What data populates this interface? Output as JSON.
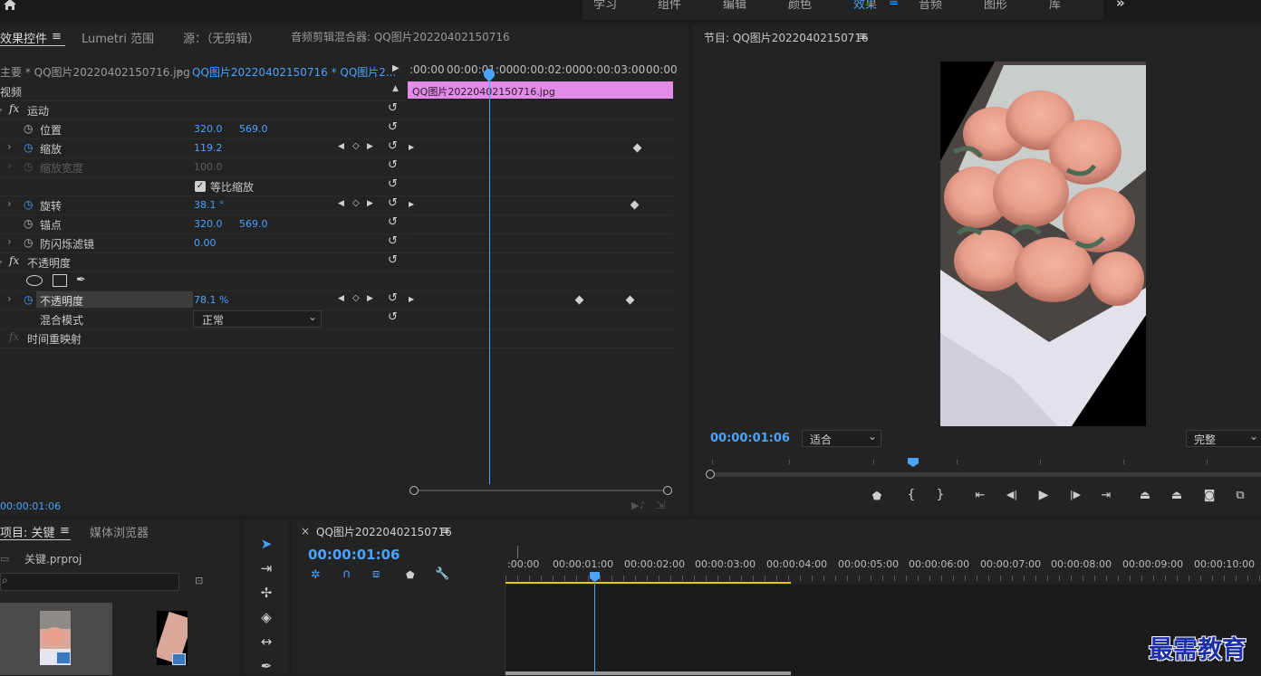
{
  "top_nav": {
    "items": [
      "学习",
      "组件",
      "编辑",
      "颜色",
      "效果",
      "音频",
      "图形",
      "库"
    ],
    "active_index": 4,
    "more": "»"
  },
  "effect_controls": {
    "tabs": [
      "效果控件",
      "Lumetri 范围",
      "源：（无剪辑）",
      "音频剪辑混合器: QQ图片20220402150716"
    ],
    "active_tab_menu": "≡",
    "master_clip": "主要 * QQ图片20220402150716.jpg",
    "sequence_clip": "QQ图片20220402150716 * QQ图片2...",
    "video_header": "视频",
    "motion": "运动",
    "position": {
      "label": "位置",
      "x": "320.0",
      "y": "569.0"
    },
    "scale": {
      "label": "缩放",
      "value": "119.2"
    },
    "scale_width": {
      "label": "缩放宽度",
      "value": "100.0"
    },
    "uniform_scale": "等比缩放",
    "rotation": {
      "label": "旋转",
      "value": "38.1 °"
    },
    "anchor": {
      "label": "锚点",
      "x": "320.0",
      "y": "569.0"
    },
    "anti_flicker": {
      "label": "防闪烁滤镜",
      "value": "0.00"
    },
    "opacity_group": "不透明度",
    "opacity": {
      "label": "不透明度",
      "value": "78.1 %"
    },
    "blend_mode": {
      "label": "混合模式",
      "value": "正常"
    },
    "time_remap": "时间重映射",
    "timecode": "00:00:01:06",
    "ruler": [
      ":00:00",
      "00:00:01:00",
      "00:00:02:00",
      "00:00:03:00",
      "00:00"
    ],
    "clip_name": "QQ图片20220402150716.jpg"
  },
  "program_monitor": {
    "title": "节目: QQ图片20220402150716",
    "menu": "≡",
    "timecode": "00:00:01:06",
    "fit": "适合",
    "quality": "完整"
  },
  "project": {
    "tabs": [
      "项目: 关键",
      "媒体浏览器"
    ],
    "menu": "≡",
    "file": "关键.prproj",
    "search_placeholder": ""
  },
  "timeline": {
    "close": "×",
    "title": "QQ图片20220402150716",
    "menu": "≡",
    "timecode": "00:00:01:06",
    "ruler": [
      ":00:00",
      "00:00:01:00",
      "00:00:02:00",
      "00:00:03:00",
      "00:00:04:00",
      "00:00:05:00",
      "00:00:06:00",
      "00:00:07:00",
      "00:00:08:00",
      "00:00:09:00",
      "00:00:10:00"
    ]
  },
  "watermark": "最需教育",
  "colors": {
    "accent": "#4aa3ff",
    "clip": "#e38be8",
    "work_area": "#e6d000"
  }
}
